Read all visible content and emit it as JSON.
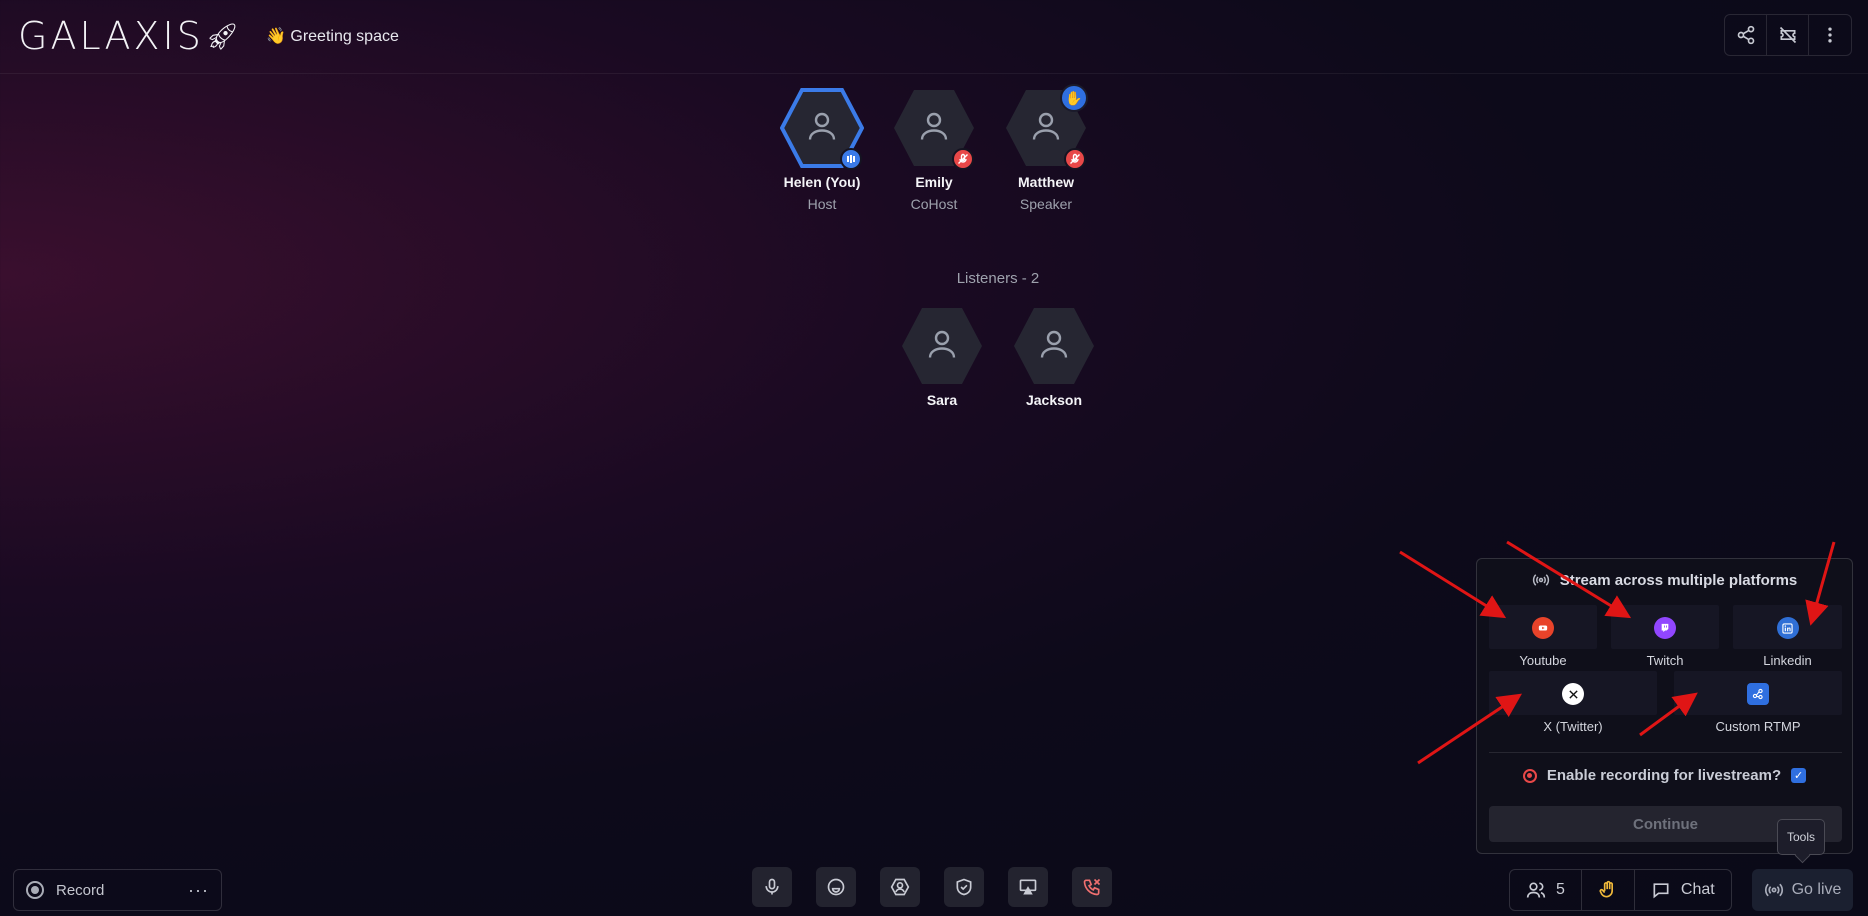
{
  "app": {
    "logo": "GALAXIS",
    "space_title": "👋 Greeting space"
  },
  "speakers": [
    {
      "name": "Helen (You)",
      "role": "Host",
      "status": "speaking"
    },
    {
      "name": "Emily",
      "role": "CoHost",
      "status": "muted"
    },
    {
      "name": "Matthew",
      "role": "Speaker",
      "status": "muted",
      "hand_raised": true
    }
  ],
  "listeners_title": "Listeners - 2",
  "listeners": [
    {
      "name": "Sara"
    },
    {
      "name": "Jackson"
    }
  ],
  "stream_panel": {
    "title": "Stream across multiple platforms",
    "platforms": [
      {
        "label": "Youtube",
        "color": "#e8432a"
      },
      {
        "label": "Twitch",
        "color": "#9146ff"
      },
      {
        "label": "Linkedin",
        "color": "#2f6fd6"
      },
      {
        "label": "X (Twitter)",
        "color": "#ffffff"
      },
      {
        "label": "Custom RTMP",
        "color": "#2f6fe0"
      }
    ],
    "recording_label": "Enable recording for livestream?",
    "recording_enabled": true,
    "continue_label": "Continue"
  },
  "tooltip": "Tools",
  "bottom": {
    "record_label": "Record",
    "record_more": "···",
    "participants_count": "5",
    "chat_label": "Chat",
    "golive_label": "Go live"
  }
}
